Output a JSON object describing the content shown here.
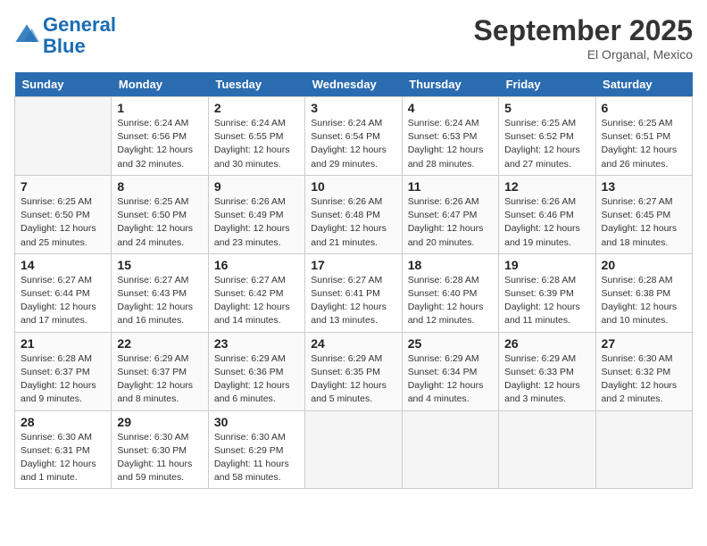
{
  "logo": {
    "line1": "General",
    "line2": "Blue"
  },
  "title": "September 2025",
  "location": "El Organal, Mexico",
  "days_header": [
    "Sunday",
    "Monday",
    "Tuesday",
    "Wednesday",
    "Thursday",
    "Friday",
    "Saturday"
  ],
  "weeks": [
    [
      {
        "day": "",
        "info": ""
      },
      {
        "day": "1",
        "info": "Sunrise: 6:24 AM\nSunset: 6:56 PM\nDaylight: 12 hours\nand 32 minutes."
      },
      {
        "day": "2",
        "info": "Sunrise: 6:24 AM\nSunset: 6:55 PM\nDaylight: 12 hours\nand 30 minutes."
      },
      {
        "day": "3",
        "info": "Sunrise: 6:24 AM\nSunset: 6:54 PM\nDaylight: 12 hours\nand 29 minutes."
      },
      {
        "day": "4",
        "info": "Sunrise: 6:24 AM\nSunset: 6:53 PM\nDaylight: 12 hours\nand 28 minutes."
      },
      {
        "day": "5",
        "info": "Sunrise: 6:25 AM\nSunset: 6:52 PM\nDaylight: 12 hours\nand 27 minutes."
      },
      {
        "day": "6",
        "info": "Sunrise: 6:25 AM\nSunset: 6:51 PM\nDaylight: 12 hours\nand 26 minutes."
      }
    ],
    [
      {
        "day": "7",
        "info": "Sunrise: 6:25 AM\nSunset: 6:50 PM\nDaylight: 12 hours\nand 25 minutes."
      },
      {
        "day": "8",
        "info": "Sunrise: 6:25 AM\nSunset: 6:50 PM\nDaylight: 12 hours\nand 24 minutes."
      },
      {
        "day": "9",
        "info": "Sunrise: 6:26 AM\nSunset: 6:49 PM\nDaylight: 12 hours\nand 23 minutes."
      },
      {
        "day": "10",
        "info": "Sunrise: 6:26 AM\nSunset: 6:48 PM\nDaylight: 12 hours\nand 21 minutes."
      },
      {
        "day": "11",
        "info": "Sunrise: 6:26 AM\nSunset: 6:47 PM\nDaylight: 12 hours\nand 20 minutes."
      },
      {
        "day": "12",
        "info": "Sunrise: 6:26 AM\nSunset: 6:46 PM\nDaylight: 12 hours\nand 19 minutes."
      },
      {
        "day": "13",
        "info": "Sunrise: 6:27 AM\nSunset: 6:45 PM\nDaylight: 12 hours\nand 18 minutes."
      }
    ],
    [
      {
        "day": "14",
        "info": "Sunrise: 6:27 AM\nSunset: 6:44 PM\nDaylight: 12 hours\nand 17 minutes."
      },
      {
        "day": "15",
        "info": "Sunrise: 6:27 AM\nSunset: 6:43 PM\nDaylight: 12 hours\nand 16 minutes."
      },
      {
        "day": "16",
        "info": "Sunrise: 6:27 AM\nSunset: 6:42 PM\nDaylight: 12 hours\nand 14 minutes."
      },
      {
        "day": "17",
        "info": "Sunrise: 6:27 AM\nSunset: 6:41 PM\nDaylight: 12 hours\nand 13 minutes."
      },
      {
        "day": "18",
        "info": "Sunrise: 6:28 AM\nSunset: 6:40 PM\nDaylight: 12 hours\nand 12 minutes."
      },
      {
        "day": "19",
        "info": "Sunrise: 6:28 AM\nSunset: 6:39 PM\nDaylight: 12 hours\nand 11 minutes."
      },
      {
        "day": "20",
        "info": "Sunrise: 6:28 AM\nSunset: 6:38 PM\nDaylight: 12 hours\nand 10 minutes."
      }
    ],
    [
      {
        "day": "21",
        "info": "Sunrise: 6:28 AM\nSunset: 6:37 PM\nDaylight: 12 hours\nand 9 minutes."
      },
      {
        "day": "22",
        "info": "Sunrise: 6:29 AM\nSunset: 6:37 PM\nDaylight: 12 hours\nand 8 minutes."
      },
      {
        "day": "23",
        "info": "Sunrise: 6:29 AM\nSunset: 6:36 PM\nDaylight: 12 hours\nand 6 minutes."
      },
      {
        "day": "24",
        "info": "Sunrise: 6:29 AM\nSunset: 6:35 PM\nDaylight: 12 hours\nand 5 minutes."
      },
      {
        "day": "25",
        "info": "Sunrise: 6:29 AM\nSunset: 6:34 PM\nDaylight: 12 hours\nand 4 minutes."
      },
      {
        "day": "26",
        "info": "Sunrise: 6:29 AM\nSunset: 6:33 PM\nDaylight: 12 hours\nand 3 minutes."
      },
      {
        "day": "27",
        "info": "Sunrise: 6:30 AM\nSunset: 6:32 PM\nDaylight: 12 hours\nand 2 minutes."
      }
    ],
    [
      {
        "day": "28",
        "info": "Sunrise: 6:30 AM\nSunset: 6:31 PM\nDaylight: 12 hours\nand 1 minute."
      },
      {
        "day": "29",
        "info": "Sunrise: 6:30 AM\nSunset: 6:30 PM\nDaylight: 11 hours\nand 59 minutes."
      },
      {
        "day": "30",
        "info": "Sunrise: 6:30 AM\nSunset: 6:29 PM\nDaylight: 11 hours\nand 58 minutes."
      },
      {
        "day": "",
        "info": ""
      },
      {
        "day": "",
        "info": ""
      },
      {
        "day": "",
        "info": ""
      },
      {
        "day": "",
        "info": ""
      }
    ]
  ]
}
